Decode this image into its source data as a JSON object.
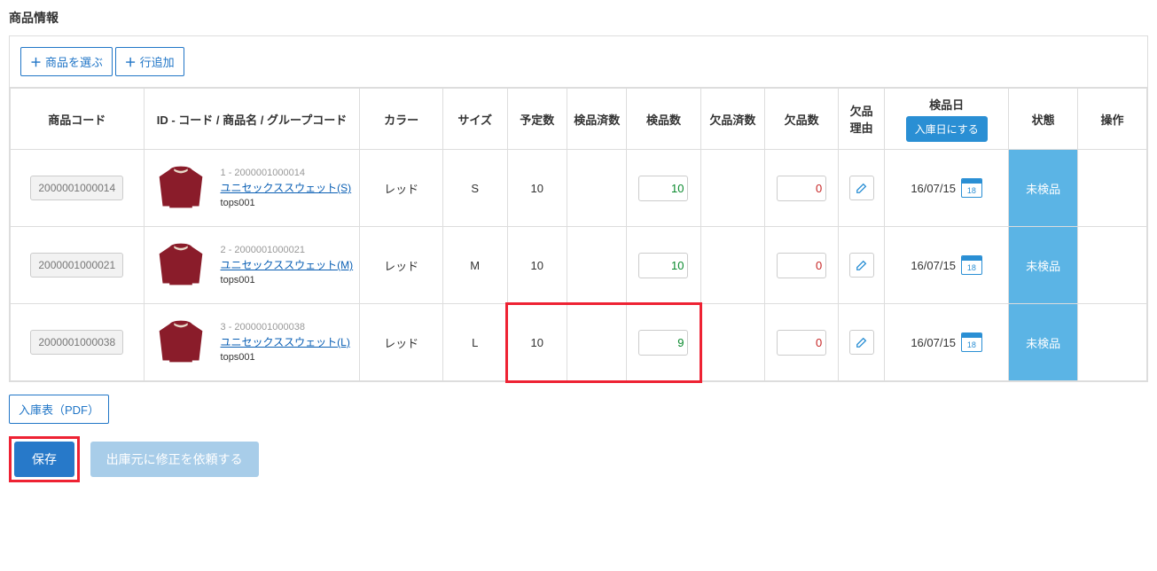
{
  "section_title": "商品情報",
  "toolbar": {
    "select_product": "商品を選ぶ",
    "add_row": "行追加"
  },
  "columns": {
    "code": "商品コード",
    "name": "ID - コード / 商品名 / グループコード",
    "color": "カラー",
    "size": "サイズ",
    "planned": "予定数",
    "inspected_done": "検品済数",
    "inspect_qty": "検品数",
    "shortage_done": "欠品済数",
    "shortage_qty": "欠品数",
    "reason": "欠品理由",
    "inspect_date": "検品日",
    "inspect_date_btn": "入庫日にする",
    "state": "状態",
    "operation": "操作"
  },
  "cal_day": "18",
  "rows": [
    {
      "code": "2000001000014",
      "id_line": "1 - 2000001000014",
      "name": "ユニセックススウェット(S)",
      "group": "tops001",
      "color": "レッド",
      "size": "S",
      "planned": "10",
      "inspect_qty": "10",
      "shortage_qty": "0",
      "date": "16/07/15",
      "state": "未検品"
    },
    {
      "code": "2000001000021",
      "id_line": "2 - 2000001000021",
      "name": "ユニセックススウェット(M)",
      "group": "tops001",
      "color": "レッド",
      "size": "M",
      "planned": "10",
      "inspect_qty": "10",
      "shortage_qty": "0",
      "date": "16/07/15",
      "state": "未検品"
    },
    {
      "code": "2000001000038",
      "id_line": "3 - 2000001000038",
      "name": "ユニセックススウェット(L)",
      "group": "tops001",
      "color": "レッド",
      "size": "L",
      "planned": "10",
      "inspect_qty": "9",
      "shortage_qty": "0",
      "date": "16/07/15",
      "state": "未検品"
    }
  ],
  "footer": {
    "pdf": "入庫表（PDF）",
    "save": "保存",
    "request": "出庫元に修正を依頼する"
  },
  "highlight_row": 2
}
